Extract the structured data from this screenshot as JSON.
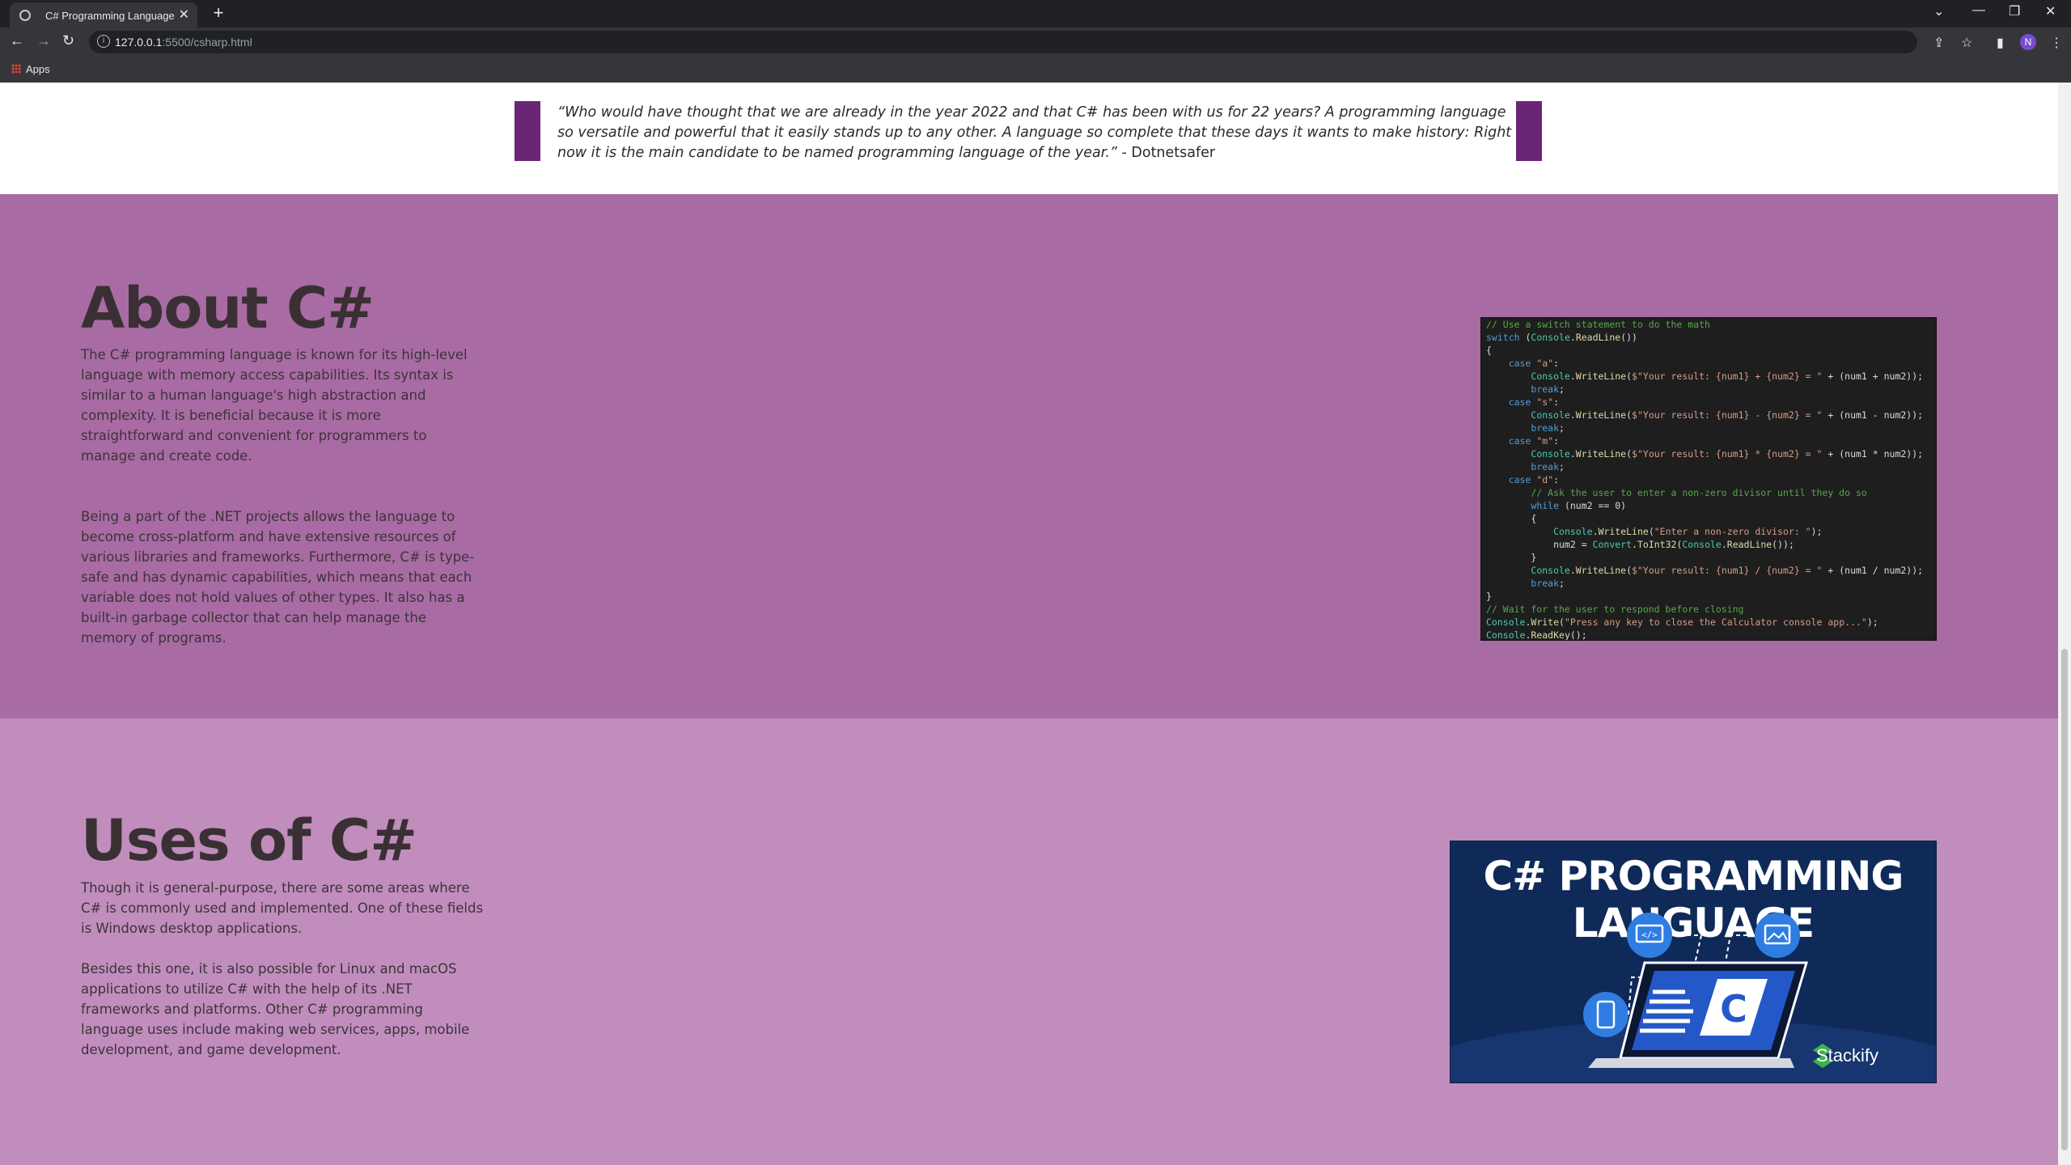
{
  "browser": {
    "tab_title": "C# Programming Language",
    "url_host": "127.0.0.1",
    "url_path": ":5500/csharp.html",
    "bookmark_apps": "Apps",
    "avatar_initial": "N"
  },
  "quote": {
    "text": "“Who would have thought that we are already in the year 2022 and that C# has been with us for 22 years? A programming language so versatile and powerful that it easily stands up to any other. A language so complete that these days it wants to make history: Right now it is the main candidate to be named programming language of the year.”",
    "source": " - Dotnetsafer"
  },
  "about": {
    "title": "About C#",
    "p1": "The C# programming language is known for its high-level language with memory access capabilities. Its syntax is similar to a human language's high abstraction and complexity. It is beneficial because it is more straightforward and convenient for programmers to manage and create code.",
    "p2": "Being a part of the .NET projects allows the language to become cross-platform and have extensive resources of various libraries and frameworks. Furthermore, C# is type-safe and has dynamic capabilities, which means that each variable does not hold values of other types. It also has a built-in garbage collector that can help manage the memory of programs."
  },
  "code_lines": [
    "// Use a switch statement to do the math",
    "switch (Console.ReadLine())",
    "{",
    "    case \"a\":",
    "        Console.WriteLine($\"Your result: {num1} + {num2} = \" + (num1 + num2));",
    "        break;",
    "    case \"s\":",
    "        Console.WriteLine($\"Your result: {num1} - {num2} = \" + (num1 - num2));",
    "        break;",
    "    case \"m\":",
    "        Console.WriteLine($\"Your result: {num1} * {num2} = \" + (num1 * num2));",
    "        break;",
    "    case \"d\":",
    "        // Ask the user to enter a non-zero divisor until they do so",
    "        while (num2 == 0)",
    "        {",
    "            Console.WriteLine(\"Enter a non-zero divisor: \");",
    "            num2 = Convert.ToInt32(Console.ReadLine());",
    "        }",
    "        Console.WriteLine($\"Your result: {num1} / {num2} = \" + (num1 / num2));",
    "        break;",
    "}",
    "// Wait for the user to respond before closing",
    "Console.Write(\"Press any key to close the Calculator console app...\");",
    "Console.ReadKey();"
  ],
  "uses": {
    "title": "Uses of C#",
    "p1": "Though it is general-purpose, there are some areas where C# is commonly used and implemented. One of these fields is Windows desktop applications.",
    "p2": "Besides this one, it is also possible for Linux and macOS applications to utilize C# with the help of its .NET frameworks and platforms. Other C# programming language uses include making web services, apps, mobile development, and game development."
  },
  "promo": {
    "title": "C# PROGRAMMING LANGUAGE",
    "brand": "Stackify"
  },
  "colors": {
    "about_bg": "#a86ba4",
    "uses_bg": "#c08dbd",
    "quote_bar": "#6b2577"
  }
}
